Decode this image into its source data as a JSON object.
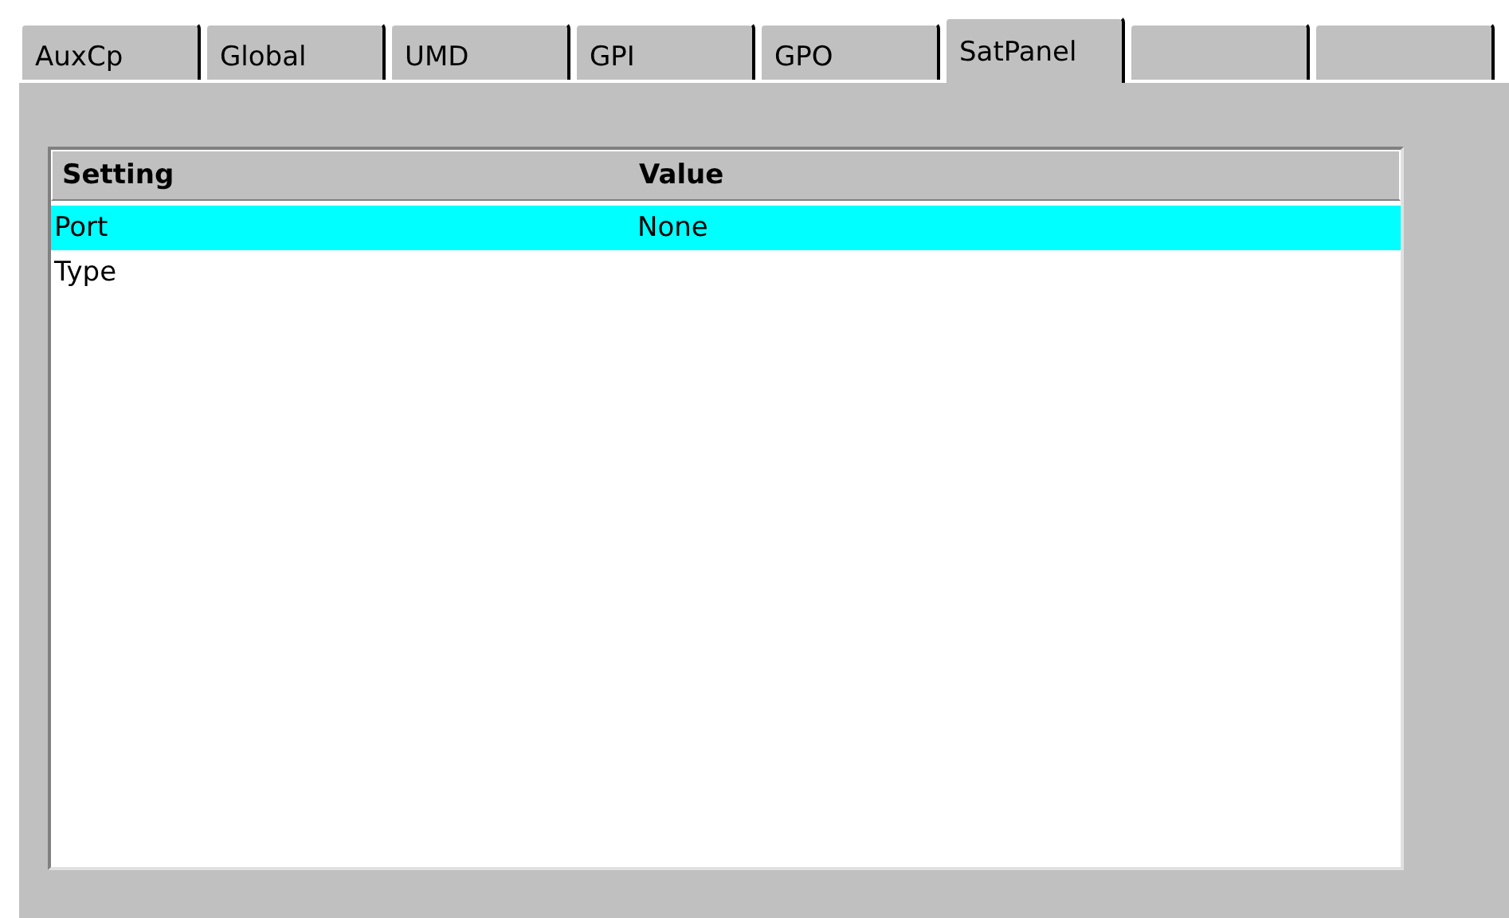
{
  "tabs": [
    {
      "label": "AuxCp",
      "selected": false
    },
    {
      "label": "Global",
      "selected": false
    },
    {
      "label": "UMD",
      "selected": false
    },
    {
      "label": "GPI",
      "selected": false
    },
    {
      "label": "GPO",
      "selected": false
    },
    {
      "label": "SatPanel",
      "selected": true
    },
    {
      "selected": false
    },
    {
      "selected": false
    }
  ],
  "table": {
    "columns": [
      "Setting",
      "Value"
    ],
    "rows": [
      {
        "cells": [
          "Port",
          "None"
        ],
        "selected": true
      },
      {
        "cells": [
          "Type"
        ],
        "selected": false
      }
    ]
  }
}
